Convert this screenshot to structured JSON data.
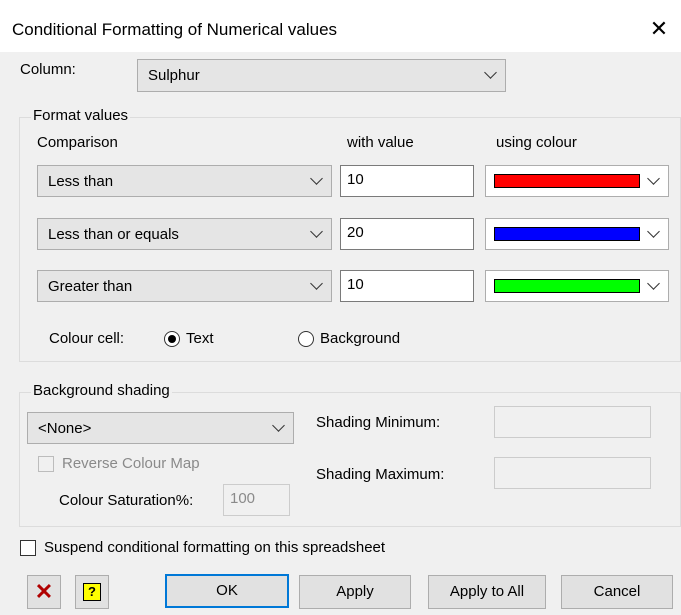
{
  "dialog": {
    "title": "Conditional Formatting of Numerical values",
    "close_icon": "close-icon"
  },
  "column": {
    "label": "Column:",
    "value": "Sulphur"
  },
  "format_values": {
    "legend": "Format values",
    "headers": {
      "comparison": "Comparison",
      "with_value": "with value",
      "using_colour": "using colour"
    },
    "rules": [
      {
        "comparison": "Less than",
        "value": "10",
        "colour": "#ff0000"
      },
      {
        "comparison": "Less than or equals",
        "value": "20",
        "colour": "#0000ff"
      },
      {
        "comparison": "Greater than",
        "value": "10",
        "colour": "#00ff00"
      }
    ],
    "colour_cell": {
      "label": "Colour cell:",
      "options": [
        "Text",
        "Background"
      ],
      "selected": "Text"
    }
  },
  "background_shading": {
    "legend": "Background shading",
    "shading_value": "<None>",
    "reverse_colour_map": "Reverse Colour Map",
    "colour_saturation_label": "Colour Saturation%:",
    "colour_saturation_value": "100",
    "shading_minimum_label": "Shading Minimum:",
    "shading_maximum_label": "Shading Maximum:",
    "shading_minimum_value": "",
    "shading_maximum_value": ""
  },
  "suspend": {
    "label": "Suspend conditional formatting on this spreadsheet"
  },
  "footer": {
    "delete_icon": "red-x-icon",
    "help_icon": "help-question-icon",
    "ok": "OK",
    "apply": "Apply",
    "apply_all": "Apply to All",
    "cancel": "Cancel"
  }
}
